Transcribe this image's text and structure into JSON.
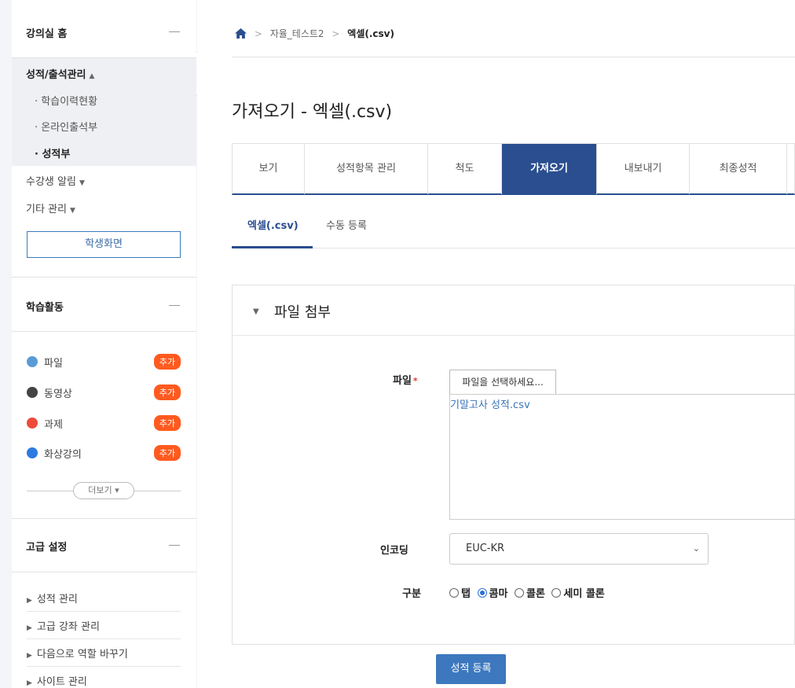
{
  "sidebar": {
    "course_home": "강의실 홈",
    "grade_menu": "성적/출석관리",
    "grade_items": [
      "학습이력현황",
      "온라인출석부",
      "성적부"
    ],
    "student_notice": "수강생 알림",
    "other_manage": "기타 관리",
    "student_view_button": "학생화면",
    "activities_title": "학습활동",
    "activities": [
      {
        "label": "파일",
        "add": "추가",
        "color": "#5b9bd5"
      },
      {
        "label": "동영상",
        "add": "추가",
        "color": "#444444"
      },
      {
        "label": "과제",
        "add": "추가",
        "color": "#ee4b3b"
      },
      {
        "label": "화상강의",
        "add": "추가",
        "color": "#2d7be0"
      }
    ],
    "more_button": "더보기",
    "advanced_title": "고급 설정",
    "advanced_items": [
      "성적 관리",
      "고급 강좌 관리",
      "다음으로 역할 바꾸기",
      "사이트 관리"
    ]
  },
  "breadcrumb": {
    "course": "자율_테스트2",
    "current": "엑셀(.csv)"
  },
  "page_title": "가져오기 - 엑셀(.csv)",
  "tabs": [
    {
      "label": "보기",
      "active": false
    },
    {
      "label": "성적항목 관리",
      "active": false
    },
    {
      "label": "척도",
      "active": false
    },
    {
      "label": "가져오기",
      "active": true
    },
    {
      "label": "내보내기",
      "active": false
    },
    {
      "label": "최종성적",
      "active": false
    }
  ],
  "subtabs": [
    {
      "label": "엑셀(.csv)",
      "active": true
    },
    {
      "label": "수동 등록",
      "active": false
    }
  ],
  "form": {
    "section_title": "파일 첨부",
    "file_label": "파일",
    "required_mark": "*",
    "file_button": "파일을 선택하세요...",
    "file_name": "기말고사 성적.csv",
    "encoding_label": "인코딩",
    "encoding_value": "EUC-KR",
    "separator_label": "구분",
    "separators": [
      {
        "label": "탭",
        "selected": false
      },
      {
        "label": "콤마",
        "selected": true
      },
      {
        "label": "콜론",
        "selected": false
      },
      {
        "label": "세미 콜론",
        "selected": false
      }
    ],
    "submit": "성적 등록"
  },
  "colors": {
    "primary": "#2a4e8f",
    "accent_button": "#3d78be",
    "badge": "#ff5a1f",
    "link": "#3b73b9"
  }
}
